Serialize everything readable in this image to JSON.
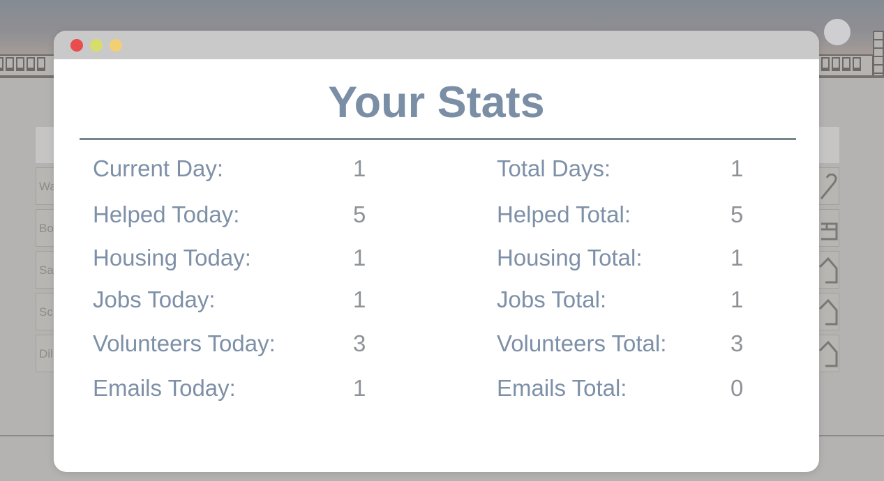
{
  "modal": {
    "title": "Your Stats",
    "window_controls": [
      "close",
      "minimize",
      "zoom"
    ]
  },
  "stats": {
    "left": [
      {
        "label": "Current Day:",
        "value": "1"
      },
      {
        "label": "Helped Today:",
        "value": "5"
      },
      {
        "label": "Housing Today:",
        "value": "1"
      },
      {
        "label": "Jobs Today:",
        "value": "1"
      },
      {
        "label": "Volunteers Today:",
        "value": "3"
      },
      {
        "label": "Emails Today:",
        "value": "1"
      }
    ],
    "right": [
      {
        "label": "Total Days:",
        "value": "1"
      },
      {
        "label": "Helped Total:",
        "value": "5"
      },
      {
        "label": "Housing Total:",
        "value": "1"
      },
      {
        "label": "Jobs Total:",
        "value": "1"
      },
      {
        "label": "Volunteers Total:",
        "value": "3"
      },
      {
        "label": "Emails Total:",
        "value": "0"
      }
    ]
  },
  "background": {
    "row_snippets": [
      "Wa",
      "Bo",
      "Sa",
      "Sc",
      "Dil"
    ]
  },
  "colors": {
    "title": "#7a8ea5",
    "label": "#7d90a7",
    "value": "#8e9196",
    "divider": "#75878d",
    "close": "#ea4d4d",
    "minimize": "#d7dd6b",
    "zoom": "#f2cf73"
  }
}
